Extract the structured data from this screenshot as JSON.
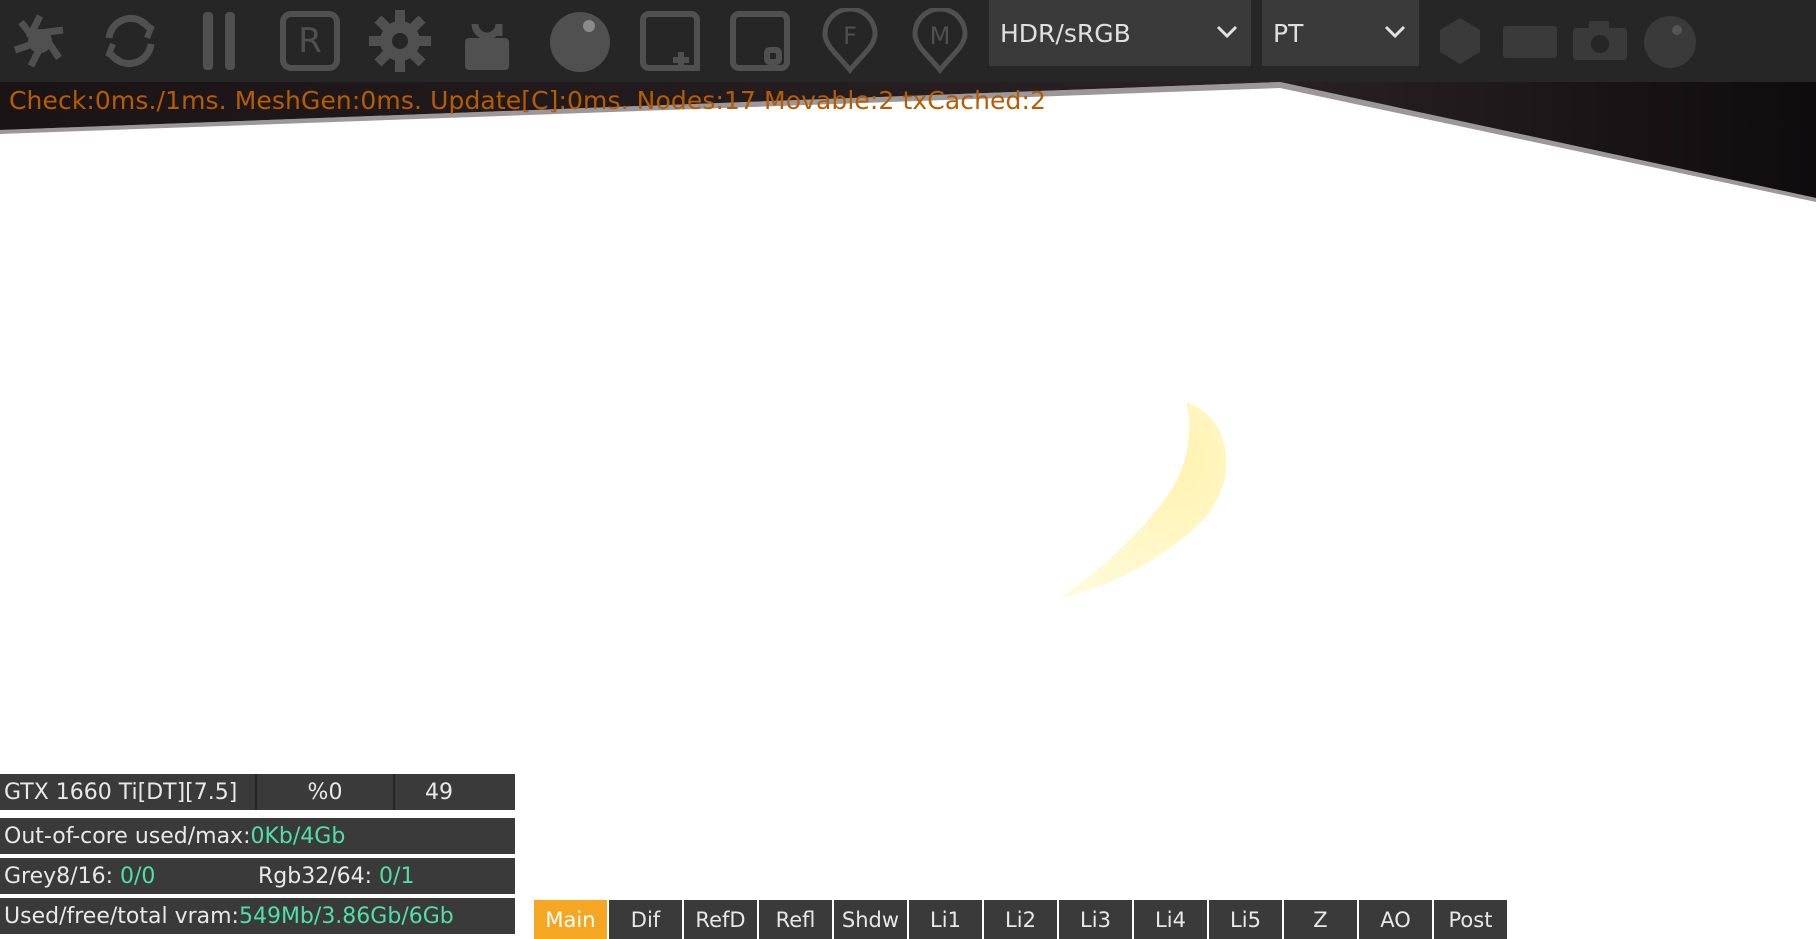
{
  "toolbar": {
    "icons": [
      "aperture-icon",
      "reload-icon",
      "pause-icon",
      "region-render-icon",
      "settings-gear-icon",
      "unlock-icon",
      "material-sphere-icon",
      "add-object-icon",
      "focus-picker-icon",
      "focus-pin-icon",
      "material-pin-icon",
      "hexagon-icon",
      "screen-icon",
      "camera-icon",
      "dark-sphere-icon"
    ],
    "icon_letters": {
      "region": "R",
      "focus_pin": "F",
      "material_pin": "M"
    },
    "color_mode": "HDR/sRGB",
    "kernel": "PT"
  },
  "viewport": {
    "stats_line": "Check:0ms./1ms. MeshGen:0ms. Update[C]:0ms. Nodes:17 Movable:2 txCached:2"
  },
  "gpu_panel": {
    "device": "GTX 1660 Ti[DT][7.5]",
    "percent": "%0",
    "count": "49",
    "out_of_core_label": "Out-of-core used/max:",
    "out_of_core_used": "0Kb",
    "out_of_core_sep": "/",
    "out_of_core_max": "4Gb",
    "grey_label": "Grey8/16: ",
    "grey_value": "0/0",
    "rgb_label": "Rgb32/64: ",
    "rgb_value": "0/1",
    "vram_label": "Used/free/total vram: ",
    "vram_used": "549Mb",
    "vram_sep1": "/",
    "vram_free": "3.86Gb",
    "vram_sep2": "/",
    "vram_total": "6Gb"
  },
  "render_passes": [
    "Main",
    "Dif",
    "RefD",
    "Refl",
    "Shdw",
    "Li1",
    "Li2",
    "Li3",
    "Li4",
    "Li5",
    "Z",
    "AO",
    "Post"
  ],
  "active_pass": "Main",
  "colors": {
    "toolbar_bg": "#262626",
    "icon": "#505050",
    "stats_text": "#b85c00",
    "highlight_value": "#4fe0a8",
    "active_pass": "#f5a623"
  }
}
